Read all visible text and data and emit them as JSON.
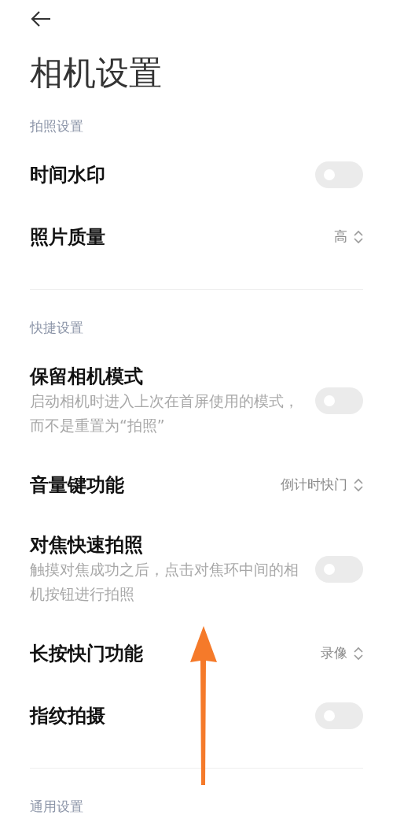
{
  "title": "相机设置",
  "sections": [
    {
      "header": "拍照设置",
      "items": [
        {
          "kind": "toggle",
          "label": "时间水印",
          "on": false
        },
        {
          "kind": "select",
          "label": "照片质量",
          "value": "高"
        }
      ]
    },
    {
      "header": "快捷设置",
      "items": [
        {
          "kind": "toggle",
          "label": "保留相机模式",
          "description": "启动相机时进入上次在首屏使用的模式，而不是重置为“拍照”",
          "on": false
        },
        {
          "kind": "select",
          "label": "音量键功能",
          "value": "倒计时快门"
        },
        {
          "kind": "toggle",
          "label": "对焦快速拍照",
          "description": "触摸对焦成功之后，点击对焦环中间的相机按钮进行拍照",
          "on": false
        },
        {
          "kind": "select",
          "label": "长按快门功能",
          "value": "录像"
        },
        {
          "kind": "toggle",
          "label": "指纹拍摄",
          "on": false
        }
      ]
    },
    {
      "header": "通用设置"
    }
  ]
}
